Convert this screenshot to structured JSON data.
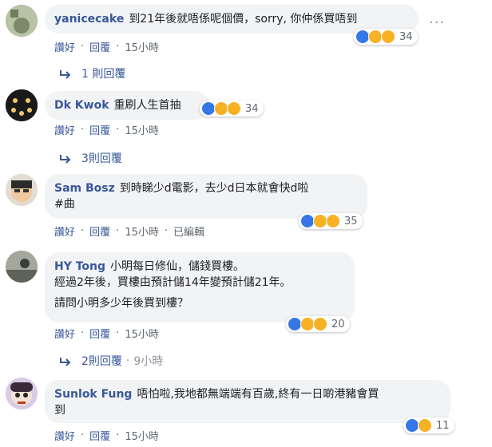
{
  "actions": {
    "like": "讚好",
    "reply": "回覆"
  },
  "comments": [
    {
      "name": "yanicecake",
      "text": "到21年後就唔係呢個價，sorry, 你仲係買唔到",
      "reactions": "34",
      "time": "15小時",
      "edited": "",
      "replies": "1 則回覆",
      "reply_time": ""
    },
    {
      "name": "Dk Kwok",
      "text": "重刷人生首抽",
      "reactions": "34",
      "time": "15小時",
      "edited": "",
      "replies": "3則回覆",
      "reply_time": ""
    },
    {
      "name": "Sam Bosz",
      "text": "到時睇少d電影，去少d日本就會快d啦",
      "text2": "#曲",
      "reactions": "35",
      "time": "15小時",
      "edited": "已編輯",
      "replies": "",
      "reply_time": ""
    },
    {
      "name": "HY Tong",
      "text": "小明每日修仙，儲錢買樓。",
      "text2": "經過2年後，買樓由預計儲14年變預計儲21年。",
      "text3": "請問小明多少年後買到樓？",
      "reactions": "20",
      "time": "15小時",
      "edited": "",
      "replies": "2則回覆",
      "reply_time": "9小時"
    },
    {
      "name": "Sunlok Fung",
      "text": "唔怕啦,我地都無端端有百歲,終有一日啲港豬會買",
      "text2": "到",
      "reactions": "11",
      "time": "15小時",
      "edited": "",
      "replies": "",
      "reply_time": ""
    }
  ],
  "more_icon": "···",
  "dot": "·"
}
